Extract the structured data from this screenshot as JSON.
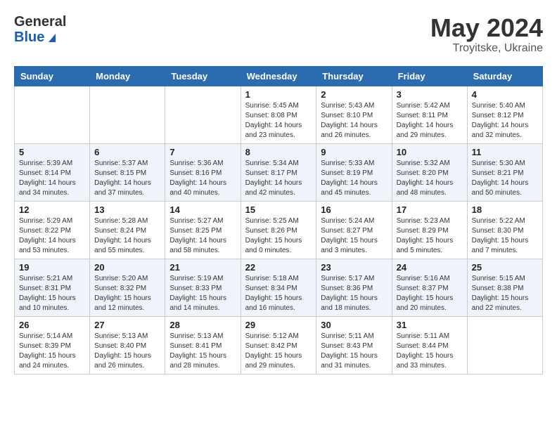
{
  "header": {
    "logo_general": "General",
    "logo_blue": "Blue",
    "month_year": "May 2024",
    "location": "Troyitske, Ukraine"
  },
  "days_of_week": [
    "Sunday",
    "Monday",
    "Tuesday",
    "Wednesday",
    "Thursday",
    "Friday",
    "Saturday"
  ],
  "weeks": [
    [
      {
        "day": "",
        "info": ""
      },
      {
        "day": "",
        "info": ""
      },
      {
        "day": "",
        "info": ""
      },
      {
        "day": "1",
        "info": "Sunrise: 5:45 AM\nSunset: 8:08 PM\nDaylight: 14 hours\nand 23 minutes."
      },
      {
        "day": "2",
        "info": "Sunrise: 5:43 AM\nSunset: 8:10 PM\nDaylight: 14 hours\nand 26 minutes."
      },
      {
        "day": "3",
        "info": "Sunrise: 5:42 AM\nSunset: 8:11 PM\nDaylight: 14 hours\nand 29 minutes."
      },
      {
        "day": "4",
        "info": "Sunrise: 5:40 AM\nSunset: 8:12 PM\nDaylight: 14 hours\nand 32 minutes."
      }
    ],
    [
      {
        "day": "5",
        "info": "Sunrise: 5:39 AM\nSunset: 8:14 PM\nDaylight: 14 hours\nand 34 minutes."
      },
      {
        "day": "6",
        "info": "Sunrise: 5:37 AM\nSunset: 8:15 PM\nDaylight: 14 hours\nand 37 minutes."
      },
      {
        "day": "7",
        "info": "Sunrise: 5:36 AM\nSunset: 8:16 PM\nDaylight: 14 hours\nand 40 minutes."
      },
      {
        "day": "8",
        "info": "Sunrise: 5:34 AM\nSunset: 8:17 PM\nDaylight: 14 hours\nand 42 minutes."
      },
      {
        "day": "9",
        "info": "Sunrise: 5:33 AM\nSunset: 8:19 PM\nDaylight: 14 hours\nand 45 minutes."
      },
      {
        "day": "10",
        "info": "Sunrise: 5:32 AM\nSunset: 8:20 PM\nDaylight: 14 hours\nand 48 minutes."
      },
      {
        "day": "11",
        "info": "Sunrise: 5:30 AM\nSunset: 8:21 PM\nDaylight: 14 hours\nand 50 minutes."
      }
    ],
    [
      {
        "day": "12",
        "info": "Sunrise: 5:29 AM\nSunset: 8:22 PM\nDaylight: 14 hours\nand 53 minutes."
      },
      {
        "day": "13",
        "info": "Sunrise: 5:28 AM\nSunset: 8:24 PM\nDaylight: 14 hours\nand 55 minutes."
      },
      {
        "day": "14",
        "info": "Sunrise: 5:27 AM\nSunset: 8:25 PM\nDaylight: 14 hours\nand 58 minutes."
      },
      {
        "day": "15",
        "info": "Sunrise: 5:25 AM\nSunset: 8:26 PM\nDaylight: 15 hours\nand 0 minutes."
      },
      {
        "day": "16",
        "info": "Sunrise: 5:24 AM\nSunset: 8:27 PM\nDaylight: 15 hours\nand 3 minutes."
      },
      {
        "day": "17",
        "info": "Sunrise: 5:23 AM\nSunset: 8:29 PM\nDaylight: 15 hours\nand 5 minutes."
      },
      {
        "day": "18",
        "info": "Sunrise: 5:22 AM\nSunset: 8:30 PM\nDaylight: 15 hours\nand 7 minutes."
      }
    ],
    [
      {
        "day": "19",
        "info": "Sunrise: 5:21 AM\nSunset: 8:31 PM\nDaylight: 15 hours\nand 10 minutes."
      },
      {
        "day": "20",
        "info": "Sunrise: 5:20 AM\nSunset: 8:32 PM\nDaylight: 15 hours\nand 12 minutes."
      },
      {
        "day": "21",
        "info": "Sunrise: 5:19 AM\nSunset: 8:33 PM\nDaylight: 15 hours\nand 14 minutes."
      },
      {
        "day": "22",
        "info": "Sunrise: 5:18 AM\nSunset: 8:34 PM\nDaylight: 15 hours\nand 16 minutes."
      },
      {
        "day": "23",
        "info": "Sunrise: 5:17 AM\nSunset: 8:36 PM\nDaylight: 15 hours\nand 18 minutes."
      },
      {
        "day": "24",
        "info": "Sunrise: 5:16 AM\nSunset: 8:37 PM\nDaylight: 15 hours\nand 20 minutes."
      },
      {
        "day": "25",
        "info": "Sunrise: 5:15 AM\nSunset: 8:38 PM\nDaylight: 15 hours\nand 22 minutes."
      }
    ],
    [
      {
        "day": "26",
        "info": "Sunrise: 5:14 AM\nSunset: 8:39 PM\nDaylight: 15 hours\nand 24 minutes."
      },
      {
        "day": "27",
        "info": "Sunrise: 5:13 AM\nSunset: 8:40 PM\nDaylight: 15 hours\nand 26 minutes."
      },
      {
        "day": "28",
        "info": "Sunrise: 5:13 AM\nSunset: 8:41 PM\nDaylight: 15 hours\nand 28 minutes."
      },
      {
        "day": "29",
        "info": "Sunrise: 5:12 AM\nSunset: 8:42 PM\nDaylight: 15 hours\nand 29 minutes."
      },
      {
        "day": "30",
        "info": "Sunrise: 5:11 AM\nSunset: 8:43 PM\nDaylight: 15 hours\nand 31 minutes."
      },
      {
        "day": "31",
        "info": "Sunrise: 5:11 AM\nSunset: 8:44 PM\nDaylight: 15 hours\nand 33 minutes."
      },
      {
        "day": "",
        "info": ""
      }
    ]
  ]
}
